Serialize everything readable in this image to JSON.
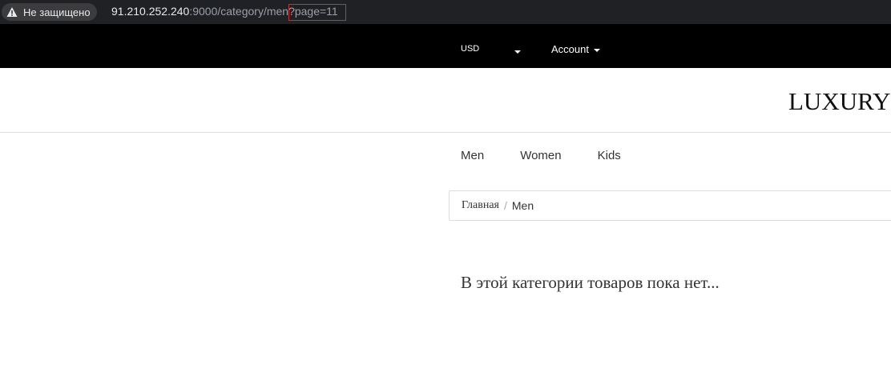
{
  "browser": {
    "security_label": "Не защищено",
    "url_host": "91.210.252.240",
    "url_rest": ":9000/category/men?",
    "url_query": "page=11",
    "highlight_color": "#d32f2f"
  },
  "topbar": {
    "currency": "USD",
    "account": "Account"
  },
  "header": {
    "logo": "LUXURY"
  },
  "nav": {
    "categories": [
      "Men",
      "Women",
      "Kids"
    ]
  },
  "breadcrumb": {
    "home": "Главная",
    "current": "Men"
  },
  "main": {
    "empty_message": "В этой категории товаров пока нет..."
  }
}
